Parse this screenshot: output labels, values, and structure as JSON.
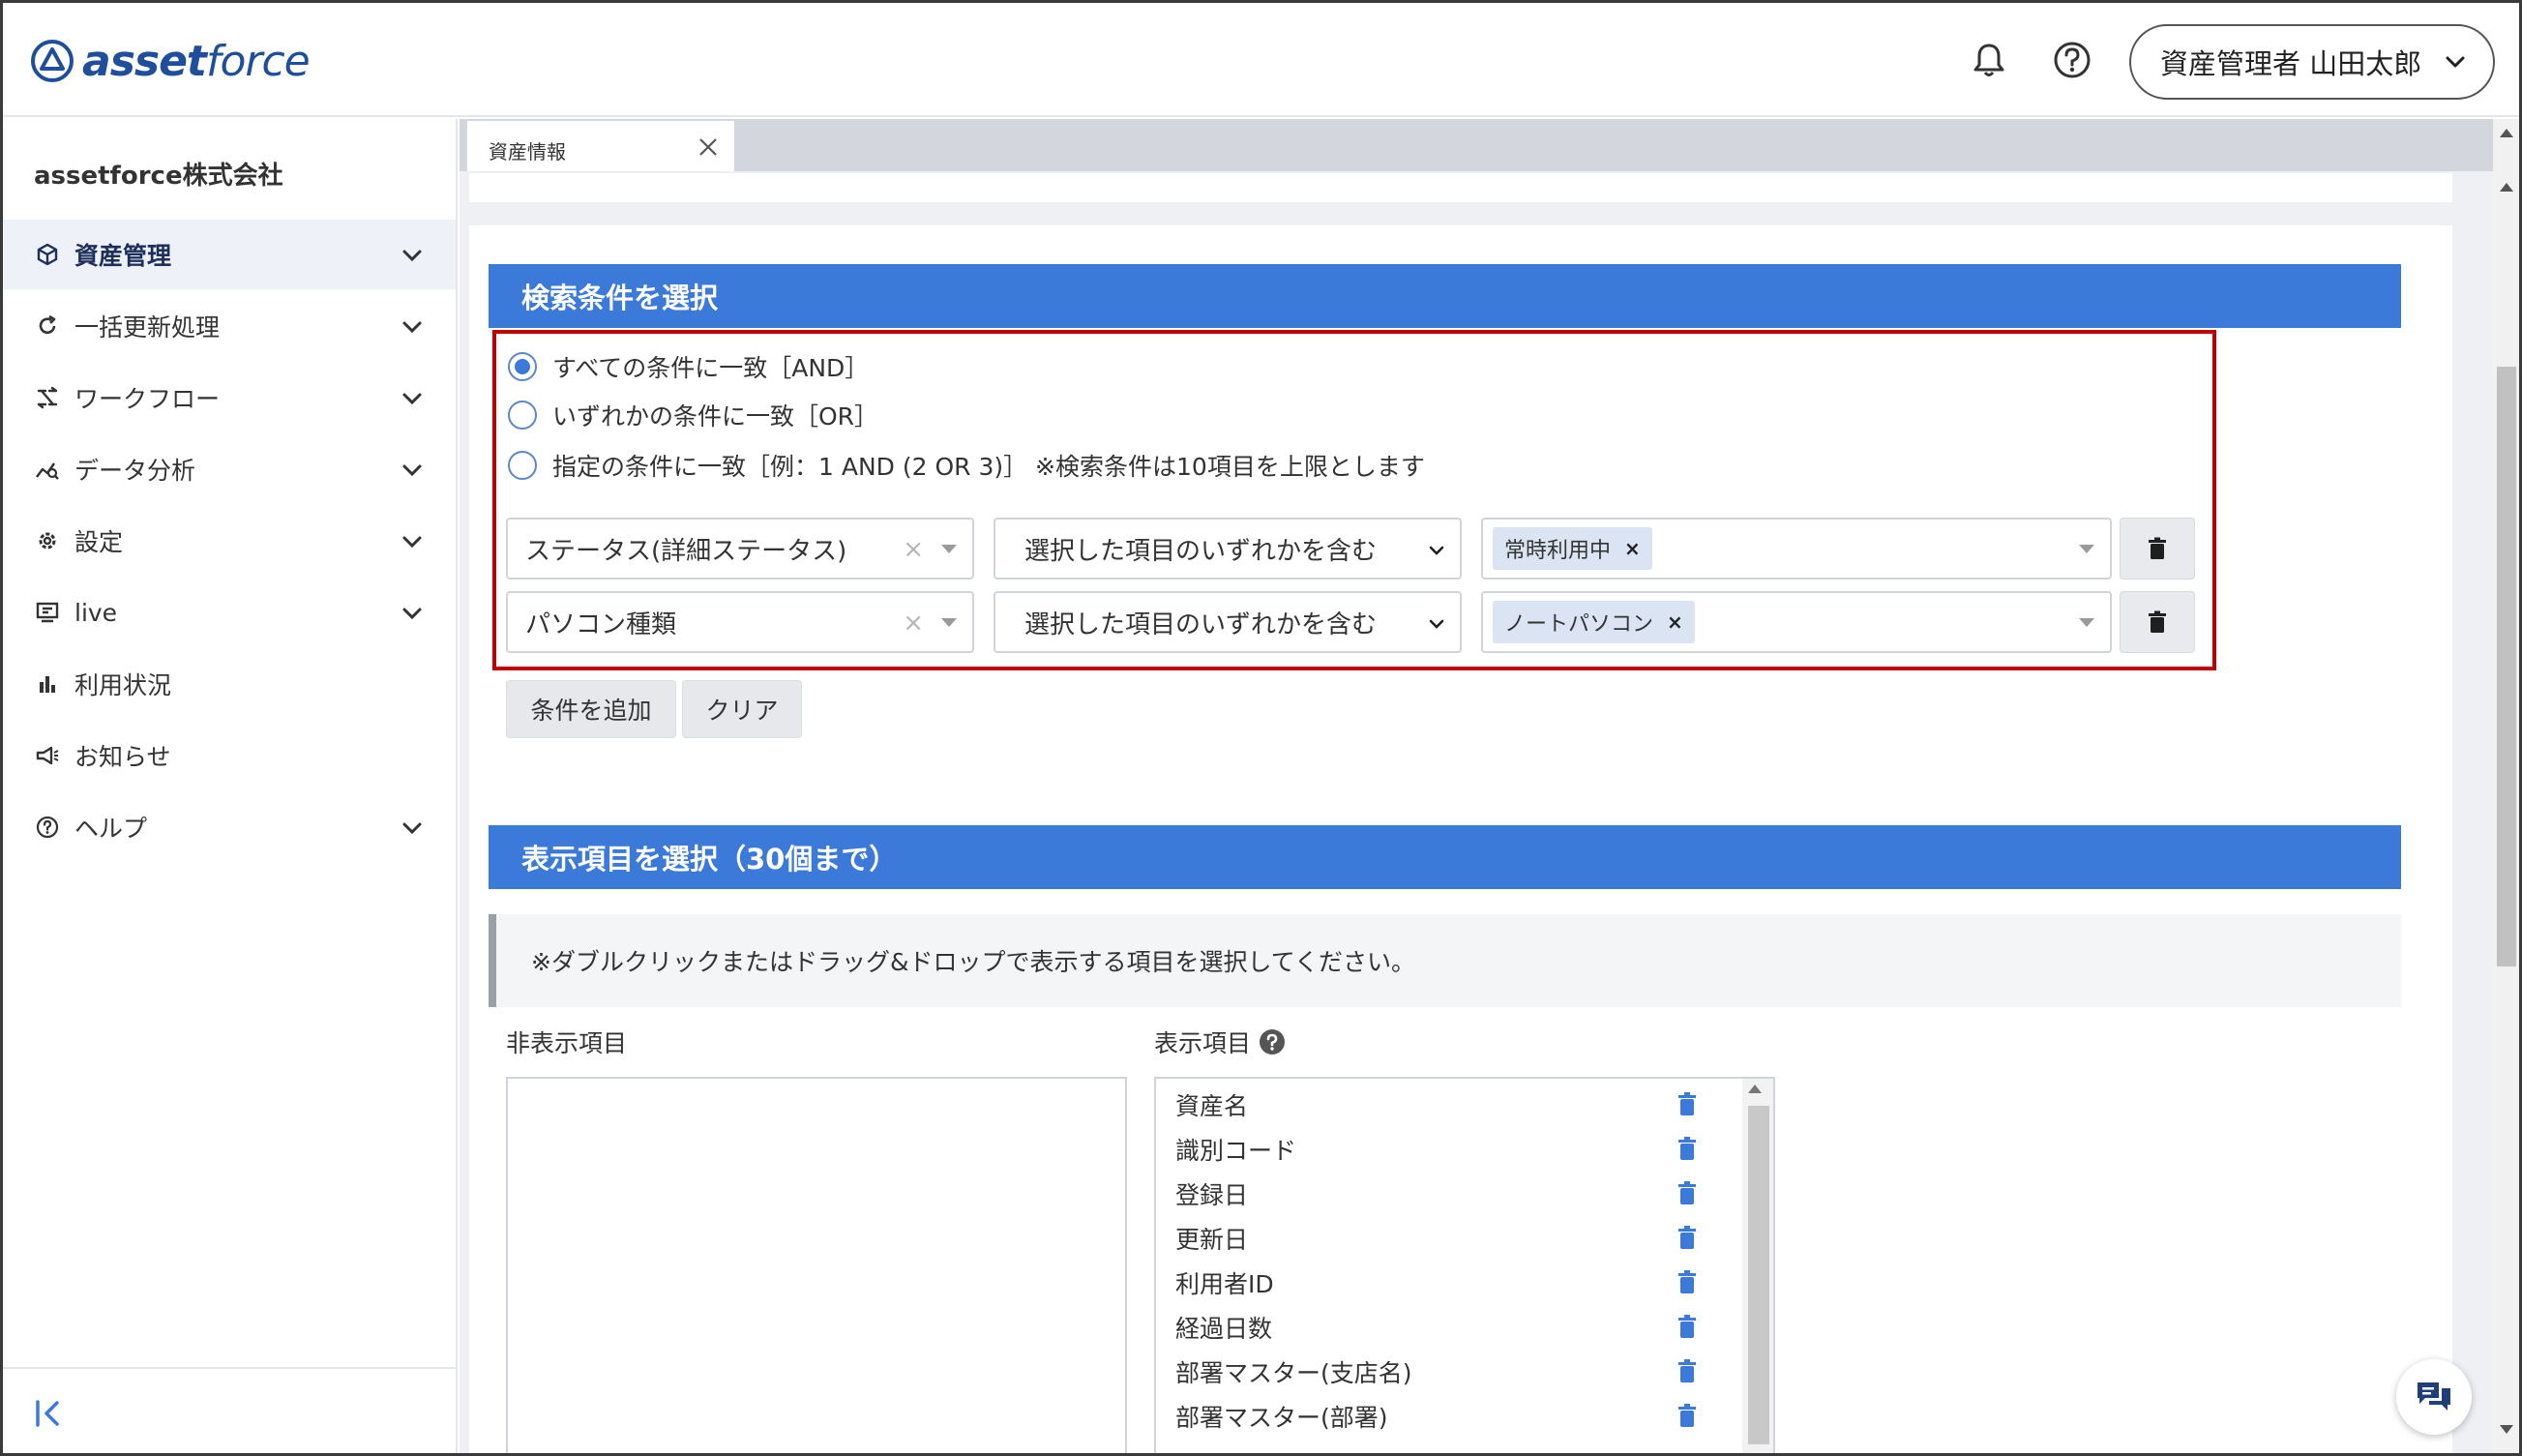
{
  "brand": {
    "logo_bold": "asset",
    "logo_light": "force",
    "color": "#1f4f9c"
  },
  "header": {
    "user_label": "資産管理者 山田太郎",
    "icons": [
      "bell-icon",
      "help-icon",
      "chevron-down-icon"
    ]
  },
  "sidebar": {
    "company": "assetforce株式会社",
    "items": [
      {
        "label": "資産管理",
        "icon": "box-icon",
        "active": true,
        "expandable": true
      },
      {
        "label": "一括更新処理",
        "icon": "refresh-icon",
        "active": false,
        "expandable": true
      },
      {
        "label": "ワークフロー",
        "icon": "workflow-icon",
        "active": false,
        "expandable": true
      },
      {
        "label": "データ分析",
        "icon": "analytics-icon",
        "active": false,
        "expandable": true
      },
      {
        "label": "設定",
        "icon": "gear-icon",
        "active": false,
        "expandable": true
      },
      {
        "label": "live",
        "icon": "live-icon",
        "active": false,
        "expandable": true
      },
      {
        "label": "利用状況",
        "icon": "bar-chart-icon",
        "active": false,
        "expandable": false
      },
      {
        "label": "お知らせ",
        "icon": "megaphone-icon",
        "active": false,
        "expandable": false
      },
      {
        "label": "ヘルプ",
        "icon": "help-circle-icon",
        "active": false,
        "expandable": true
      }
    ]
  },
  "tabs": [
    {
      "label": "資産情報",
      "active": true
    }
  ],
  "search": {
    "title": "検索条件を選択",
    "match_options": [
      {
        "label": "すべての条件に一致［AND］",
        "checked": true
      },
      {
        "label": "いずれかの条件に一致［OR］",
        "checked": false
      },
      {
        "label": "指定の条件に一致［例：1 AND (2 OR 3)］ ※検索条件は10項目を上限とします",
        "checked": false
      }
    ],
    "conditions": [
      {
        "field": "ステータス(詳細ステータス)",
        "operator": "選択した項目のいずれかを含む",
        "values": [
          "常時利用中"
        ]
      },
      {
        "field": "パソコン種類",
        "operator": "選択した項目のいずれかを含む",
        "values": [
          "ノートパソコン"
        ]
      }
    ],
    "add_button": "条件を追加",
    "clear_button": "クリア",
    "highlight_color": "#c00000"
  },
  "display": {
    "title": "表示項目を選択（30個まで）",
    "note": "※ダブルクリックまたはドラッグ&ドロップで表示する項目を選択してください。",
    "hidden_label": "非表示項目",
    "shown_label": "表示項目",
    "hidden_items": [],
    "shown_items": [
      "資産名",
      "識別コード",
      "登録日",
      "更新日",
      "利用者ID",
      "経過日数",
      "部署マスター(支店名)",
      "部署マスター(部署)"
    ]
  },
  "colors": {
    "accent": "#3b7ad9",
    "tag_bg": "#dbe4f3",
    "delete_blue": "#3b7ad9"
  }
}
